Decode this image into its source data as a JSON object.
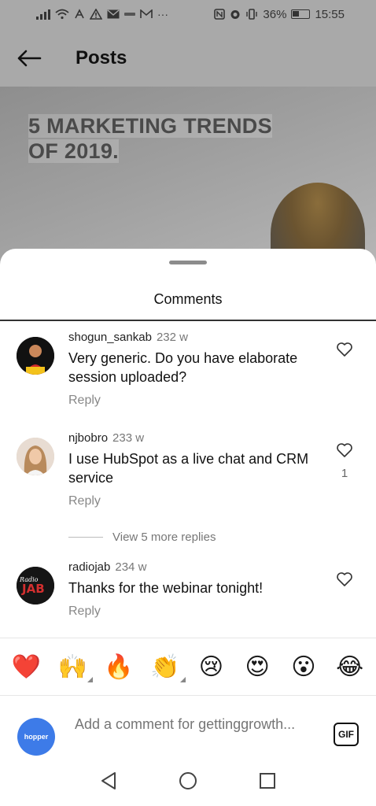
{
  "status_bar": {
    "battery": "36%",
    "time": "15:55",
    "left_icons": [
      "signal-icon",
      "wifi-icon",
      "usb-icon",
      "warning-icon",
      "mail-icon",
      "small-icon",
      "gmail-icon",
      "more-icon"
    ],
    "right_icons": [
      "nfc-icon",
      "alarm-icon",
      "vibrate-icon",
      "battery-icon"
    ]
  },
  "header": {
    "title": "Posts",
    "back_icon": "arrow-left-icon"
  },
  "post": {
    "headline_line1": "5 MARKETING TRENDS",
    "headline_line2": "OF 2019."
  },
  "sheet": {
    "title": "Comments"
  },
  "comments": [
    {
      "username": "shogun_sankab",
      "time": "232 w",
      "text": "Very generic. Do you have elaborate session uploaded?",
      "reply_label": "Reply",
      "likes": ""
    },
    {
      "username": "njbobro",
      "time": "233 w",
      "text": "I use HubSpot as a live chat and CRM service",
      "reply_label": "Reply",
      "likes": "1"
    },
    {
      "username": "radiojab",
      "time": "234 w",
      "text": "Thanks for the webinar tonight!",
      "reply_label": "Reply",
      "likes": "",
      "avatar_text_small": "Radio",
      "avatar_text": "JAB"
    }
  ],
  "more_replies": "View 5 more replies",
  "emojis": [
    {
      "glyph": "❤️",
      "name": "red-heart-emoji",
      "has_tones": false
    },
    {
      "glyph": "🙌",
      "name": "raising-hands-emoji",
      "has_tones": true
    },
    {
      "glyph": "🔥",
      "name": "fire-emoji",
      "has_tones": false
    },
    {
      "glyph": "👏",
      "name": "clapping-hands-emoji",
      "has_tones": true
    },
    {
      "glyph": "😢",
      "name": "crying-face-emoji",
      "has_tones": false
    },
    {
      "glyph": "😍",
      "name": "heart-eyes-emoji",
      "has_tones": false
    },
    {
      "glyph": "😮",
      "name": "surprised-face-emoji",
      "has_tones": false
    },
    {
      "glyph": "😂",
      "name": "tears-of-joy-emoji",
      "has_tones": false
    }
  ],
  "composer": {
    "placeholder": "Add a comment for getting​growth...",
    "gif_label": "GIF",
    "avatar_text": "hopper"
  },
  "colors": {
    "accent_blue": "#3d7be8",
    "radiojab_red": "#d32f2f",
    "heart_red": "#d9262c"
  }
}
